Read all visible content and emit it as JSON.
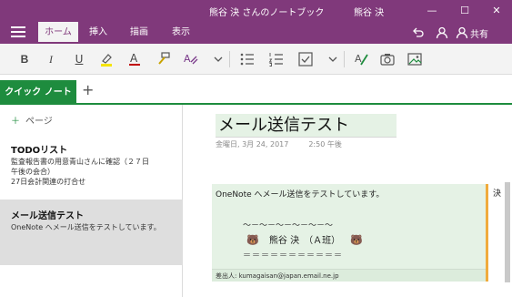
{
  "titlebar": {
    "notebook_title": "熊谷 決 さんのノートブック",
    "user_name": "熊谷 決",
    "buttons": {
      "minimize": "—",
      "maximize": "☐",
      "close": "✕"
    }
  },
  "ribbon": {
    "tabs": [
      "ホーム",
      "挿入",
      "描画",
      "表示"
    ],
    "active_tab": "ホーム",
    "share_label": "共有"
  },
  "toolbar": {
    "bold": "B",
    "italic": "I",
    "underline": "U",
    "font_color": "A",
    "icons": [
      "highlighter-icon",
      "font-color-icon",
      "format-painter-icon",
      "clear-formatting-icon",
      "bullet-list-icon",
      "numbered-list-icon",
      "checkbox-tag-icon",
      "ink-icon",
      "camera-icon",
      "picture-icon"
    ]
  },
  "sections": {
    "active_section": "クイック ノート",
    "add_section_label": "+"
  },
  "pages": {
    "add_page_label": "ページ",
    "items": [
      {
        "title": "TODOリスト",
        "snippet_lines": [
          "監査報告書の用意青山さんに確認（２７日",
          "午後の会合）",
          "27日会計関連の打合せ"
        ]
      },
      {
        "title": "メール送信テスト",
        "snippet_lines": [
          "OneNote へメール送信をテストしています。"
        ]
      }
    ],
    "selected_index": 1
  },
  "page": {
    "title": "メール送信テスト",
    "date": "金曜日, 3月 24, 2017",
    "time": "2:50 午後",
    "note_line1": "OneNote へメール送信をテストしています。",
    "note_line2": "～－～－～－～－～－～",
    "note_line3": "熊谷 決　（Ａ班）",
    "note_line4": "＝＝＝＝＝＝＝＝＝＝＝",
    "from_line": "差出人: kumagaisan@japan.email.ne.jp",
    "side_fragment": "決"
  },
  "colors": {
    "accent_purple": "#80397b",
    "section_green": "#1e8c3e",
    "note_bg": "#e5f2e5",
    "note_border": "#f0ab3c"
  }
}
